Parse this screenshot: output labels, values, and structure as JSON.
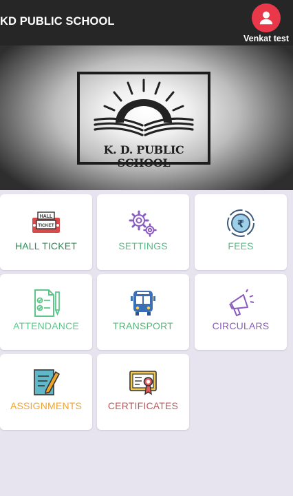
{
  "header": {
    "title": "KD PUBLIC SCHOOL",
    "user_name": "Venkat test",
    "avatar_icon": "user-icon",
    "avatar_color": "#e8384a"
  },
  "banner": {
    "logo_text": "K. D. PUBLIC SCHOOL"
  },
  "menu": [
    {
      "label": "HALL TICKET",
      "icon": "ticket-icon",
      "color": "#2e8b57",
      "badge_top": "HALL",
      "badge_bottom": "TICKET"
    },
    {
      "label": "SETTINGS",
      "icon": "gears-icon",
      "color": "#5dbb8a"
    },
    {
      "label": "FEES",
      "icon": "rupee-coin-icon",
      "color": "#4ebf86"
    },
    {
      "label": "ATTENDANCE",
      "icon": "checklist-icon",
      "color": "#5fc68a"
    },
    {
      "label": "TRANSPORT",
      "icon": "bus-icon",
      "color": "#54b978"
    },
    {
      "label": "CIRCULARS",
      "icon": "megaphone-icon",
      "color": "#8a5bbf"
    },
    {
      "label": "ASSIGNMENTS",
      "icon": "notepad-pen-icon",
      "color": "#f0a42c"
    },
    {
      "label": "CERTIFICATES",
      "icon": "certificate-icon",
      "color": "#b85a5a"
    }
  ]
}
